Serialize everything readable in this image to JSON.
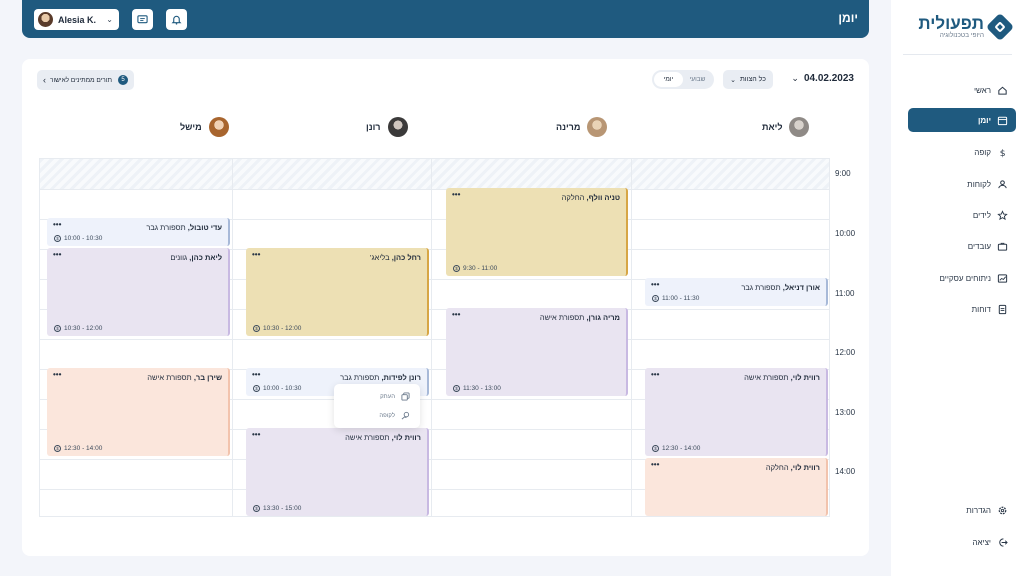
{
  "header": {
    "title": "יומן",
    "user_name": "Alesia K.",
    "bg_color": "#1f5a7f"
  },
  "sidebar": {
    "logo_main": "תפעולית",
    "logo_sub": "היופי בטכנולוגיה",
    "items": [
      {
        "label": "ראשי",
        "icon": "home-icon"
      },
      {
        "label": "יומן",
        "icon": "calendar-icon",
        "active": true
      },
      {
        "label": "קופה",
        "icon": "dollar-icon"
      },
      {
        "label": "לקוחות",
        "icon": "users-icon"
      },
      {
        "label": "לידים",
        "icon": "star-icon"
      },
      {
        "label": "עובדים",
        "icon": "briefcase-icon"
      },
      {
        "label": "ניתוחים עסקיים",
        "icon": "analytics-icon"
      },
      {
        "label": "דוחות",
        "icon": "reports-icon"
      }
    ],
    "bottom_items": [
      {
        "label": "הגדרות",
        "icon": "gear-icon"
      },
      {
        "label": "יציאה",
        "icon": "logout-icon"
      }
    ]
  },
  "toolbar": {
    "date": "04.02.2023",
    "filter_label": "כל הצוות",
    "view_daily": "יומי",
    "view_weekly": "שבועי",
    "approve_label": "תורים ממתינים לאישור",
    "approve_count": "5"
  },
  "staff": [
    "ליאת",
    "מרינה",
    "רונן",
    "מישל"
  ],
  "times": [
    "9:00",
    "10:00",
    "11:00",
    "12:00",
    "13:00",
    "14:00"
  ],
  "appointments": [
    {
      "name": "טניה וולף,",
      "service": " החלקה",
      "time": "9:30 - 11:00"
    },
    {
      "name": "עדי טובול,",
      "service": " תספורת גבר",
      "time": "10:00 - 10:30"
    },
    {
      "name": "ליאת כהן,",
      "service": " גוונים",
      "time": "10:30 - 12:00"
    },
    {
      "name": "רחל כהן,",
      "service": " בליאג'",
      "time": "10:30 - 12:00"
    },
    {
      "name": "אורן דניאל,",
      "service": " תספורת גבר",
      "time": "11:00 - 11:30"
    },
    {
      "name": "מריה גורן,",
      "service": " תספורת אישה",
      "time": "11:30 - 13:00"
    },
    {
      "name": "שירן בר,",
      "service": " תספורת אישה",
      "time": "12:30 - 14:00"
    },
    {
      "name": "רונן לפידות,",
      "service": " תספורת גבר",
      "time": "10:00 - 10:30"
    },
    {
      "name": "רווית לוי,",
      "service": " תספורת אישה",
      "time": "12:30 - 14:00"
    },
    {
      "name": "רווית לוי,",
      "service": " תספורת אישה",
      "time": "13:30 - 15:00"
    },
    {
      "name": "רווית לוי,",
      "service": " החלקה",
      "time": ""
    }
  ],
  "context_menu": {
    "copy": "העתק",
    "checkout": "לקופה"
  }
}
